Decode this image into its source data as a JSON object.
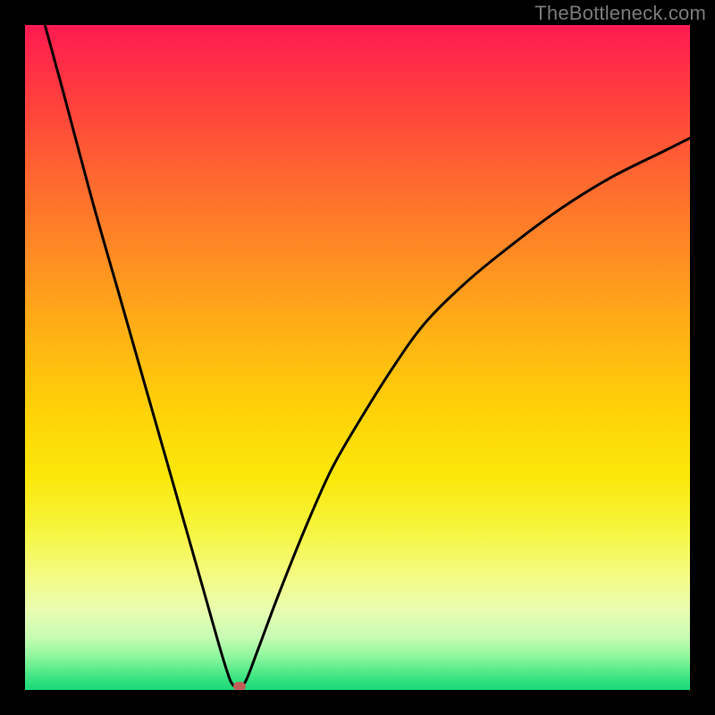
{
  "watermark": "TheBottleneck.com",
  "chart_data": {
    "type": "line",
    "title": "",
    "xlabel": "",
    "ylabel": "",
    "xlim": [
      0,
      100
    ],
    "ylim": [
      0,
      100
    ],
    "grid": false,
    "legend": false,
    "x": [
      3,
      6,
      10,
      14,
      18,
      22,
      26,
      30,
      31.5,
      33,
      35,
      38,
      42,
      46,
      50,
      55,
      60,
      66,
      72,
      80,
      88,
      96,
      100
    ],
    "values": [
      100,
      89,
      74,
      60,
      46,
      32,
      18,
      4,
      0.5,
      1,
      6,
      14,
      24,
      33,
      40,
      48,
      55,
      61,
      66,
      72,
      77,
      81,
      83
    ],
    "marker": {
      "x": 32.3,
      "y": 0.6
    },
    "colors": {
      "curve": "#000000",
      "marker": "#c06058",
      "gradient_top": "#ff1a52",
      "gradient_bottom": "#18d877",
      "frame": "#000000"
    }
  }
}
